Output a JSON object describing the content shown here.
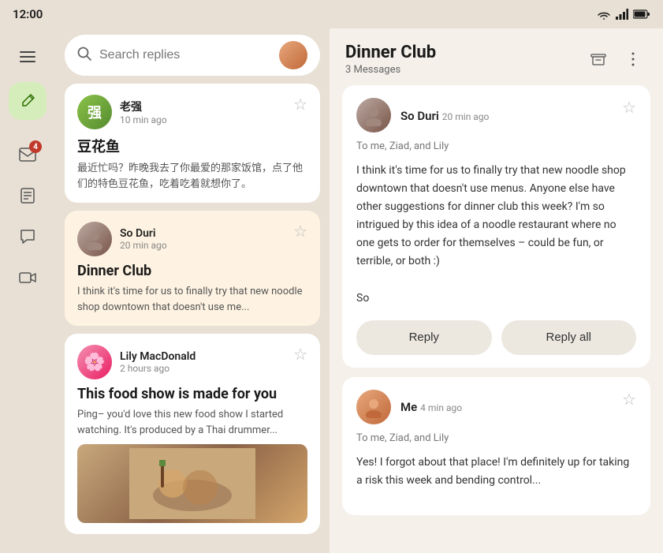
{
  "statusBar": {
    "time": "12:00",
    "icons": [
      "wifi",
      "signal",
      "battery"
    ]
  },
  "sidebar": {
    "menu_icon": "☰",
    "compose_icon": "✏",
    "mail_icon": "✉",
    "badge_count": "4",
    "notes_icon": "☰",
    "chat_icon": "💬",
    "video_icon": "📹"
  },
  "leftPanel": {
    "search": {
      "placeholder": "Search replies"
    },
    "messages": [
      {
        "id": "msg1",
        "sender": "老强",
        "time": "10 min ago",
        "subject": "豆花鱼",
        "preview": "最近忙吗？昨晚我去了你最爱的那家饭馆，点了他们的特色豆花鱼，吃着吃着就想你了。",
        "avatar_type": "laoquiang"
      },
      {
        "id": "msg2",
        "sender": "So Duri",
        "time": "20 min ago",
        "subject": "Dinner Club",
        "preview": "I think it's time for us to finally try that new noodle shop downtown that doesn't use me...",
        "avatar_type": "soduri",
        "active": true
      },
      {
        "id": "msg3",
        "sender": "Lily MacDonald",
        "time": "2 hours ago",
        "subject": "This food show is made for you",
        "preview": "Ping– you'd love this new food show I started watching. It's produced by a Thai drummer...",
        "avatar_type": "lily",
        "has_image": true
      }
    ]
  },
  "rightPanel": {
    "thread_title": "Dinner Club",
    "thread_count": "3 Messages",
    "emails": [
      {
        "id": "email1",
        "sender": "So Duri",
        "time": "20 min ago",
        "to": "To me, Ziad, and Lily",
        "body": "I think it's time for us to finally try that new noodle shop downtown that doesn't use menus. Anyone else have other suggestions for dinner club this week? I'm so intrigued by this idea of a noodle restaurant where no one gets to order for themselves – could be fun, or terrible, or both :)\n\nSo",
        "avatar_type": "soduri",
        "show_actions": true
      },
      {
        "id": "email2",
        "sender": "Me",
        "time": "4 min ago",
        "to": "To me, Ziad, and Lily",
        "body": "Yes! I forgot about that place! I'm definitely up for taking a risk this week and bending control...",
        "avatar_type": "me",
        "show_actions": false
      }
    ],
    "actions": {
      "reply_label": "Reply",
      "reply_all_label": "Reply all"
    }
  }
}
